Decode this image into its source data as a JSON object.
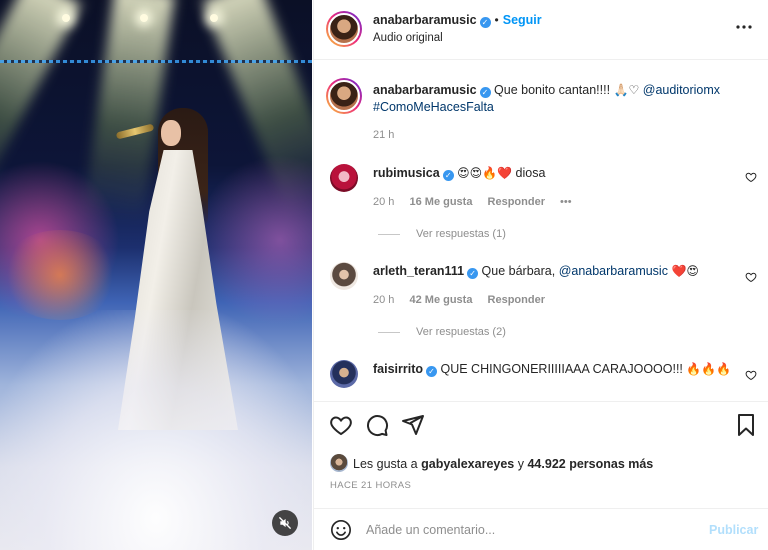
{
  "post": {
    "author": "anabarbaramusic",
    "follow_label": "Seguir",
    "dot": "•",
    "audio": "Audio original",
    "caption": {
      "text": "Que bonito cantan!!!!",
      "emojis": "🙏🏻♡",
      "mention": "@auditoriomx",
      "hashtag": "#ComoMeHacesFalta",
      "time": "21 h"
    }
  },
  "comments": [
    {
      "user": "rubimusica",
      "text": "😍😍🔥❤️",
      "text_after": " diosa",
      "time": "20 h",
      "likes": "16 Me gusta",
      "reply": "Responder",
      "more": "•••",
      "view_replies": "Ver respuestas (1)"
    },
    {
      "user": "arleth_teran111",
      "text": "Que bárbara,",
      "mention": "@anabarbaramusic",
      "emojis": "❤️😍",
      "time": "20 h",
      "likes": "42 Me gusta",
      "reply": "Responder",
      "view_replies": "Ver respuestas (2)"
    },
    {
      "user": "faisirrito",
      "text": "QUE CHINGONERIIIIIAAA CARAJOOOO!!!",
      "emojis": "🔥🔥🔥"
    }
  ],
  "likes_bar": {
    "prefix": "Les gusta a",
    "user": "gabyalexareyes",
    "middle": "y",
    "count": "44.922 personas más"
  },
  "post_time": "HACE 21 HORAS",
  "composer": {
    "placeholder": "Añade un comentario...",
    "publish": "Publicar"
  },
  "icons": {
    "like": "heart-icon",
    "comment": "comment-icon",
    "share": "share-icon",
    "save": "bookmark-icon",
    "more": "more-icon",
    "mute": "muted-speaker-icon",
    "emoji": "emoji-icon"
  },
  "colors": {
    "accent": "#0095f6",
    "verified": "#3897f0",
    "muted_text": "#8e8e8e",
    "publish_disabled": "#b2dffc"
  }
}
